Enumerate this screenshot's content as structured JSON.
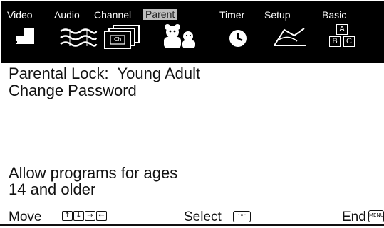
{
  "menu": {
    "tabs": [
      {
        "label": "Video",
        "icon": "video-icon"
      },
      {
        "label": "Audio",
        "icon": "audio-icon"
      },
      {
        "label": "Channel",
        "icon": "channel-icon"
      },
      {
        "label": "Parent",
        "icon": "parent-icon",
        "active": true
      },
      {
        "label": "Timer",
        "icon": "timer-icon"
      },
      {
        "label": "Setup",
        "icon": "setup-icon"
      },
      {
        "label": "Basic",
        "icon": "basic-icon"
      }
    ],
    "channel_icon_text": "Ch",
    "basic_icon_letters": [
      "A",
      "B",
      "C"
    ]
  },
  "content": {
    "parental_lock_label": "Parental Lock:",
    "parental_lock_value": "Young Adult",
    "change_password": "Change Password",
    "allow_line1": "Allow programs for ages",
    "allow_line2": "14 and older"
  },
  "footer": {
    "move_label": "Move",
    "select_label": "Select",
    "end_label": "End",
    "menu_key_text": "MENU"
  },
  "colors": {
    "menubar_bg": "#000000",
    "active_tab_bg": "#bdbdbd",
    "text": "#111111"
  }
}
